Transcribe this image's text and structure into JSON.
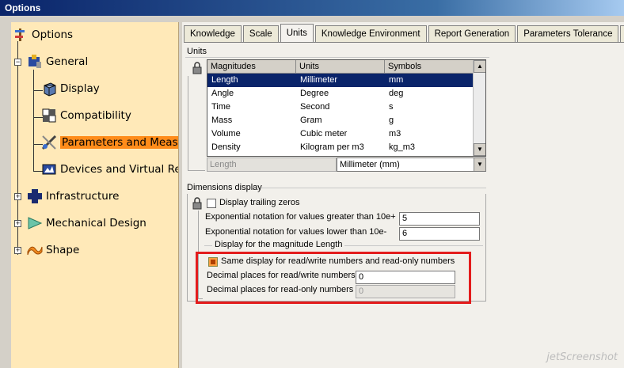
{
  "window": {
    "title": "Options"
  },
  "tree": {
    "items": [
      {
        "label": "Options",
        "icon": "options-icon"
      },
      {
        "label": "General",
        "icon": "general-icon"
      },
      {
        "label": "Display",
        "icon": "display-cube-icon"
      },
      {
        "label": "Compatibility",
        "icon": "compatibility-icon"
      },
      {
        "label": "Parameters and Measure",
        "icon": "parameters-measure-icon"
      },
      {
        "label": "Devices and Virtual Reali",
        "icon": "devices-icon"
      },
      {
        "label": "Infrastructure",
        "icon": "infrastructure-icon"
      },
      {
        "label": "Mechanical Design",
        "icon": "mechanical-design-icon"
      },
      {
        "label": "Shape",
        "icon": "shape-icon"
      }
    ]
  },
  "tabs": [
    {
      "label": "Knowledge"
    },
    {
      "label": "Scale"
    },
    {
      "label": "Units"
    },
    {
      "label": "Knowledge Environment"
    },
    {
      "label": "Report Generation"
    },
    {
      "label": "Parameters Tolerance"
    },
    {
      "label": "M"
    }
  ],
  "units_group": {
    "title": "Units",
    "headers": [
      "Magnitudes",
      "Units",
      "Symbols"
    ],
    "rows": [
      {
        "magnitude": "Length",
        "unit": "Millimeter",
        "symbol": "mm"
      },
      {
        "magnitude": "Angle",
        "unit": "Degree",
        "symbol": "deg"
      },
      {
        "magnitude": "Time",
        "unit": "Second",
        "symbol": "s"
      },
      {
        "magnitude": "Mass",
        "unit": "Gram",
        "symbol": "g"
      },
      {
        "magnitude": "Volume",
        "unit": "Cubic meter",
        "symbol": "m3"
      },
      {
        "magnitude": "Density",
        "unit": "Kilogram per m3",
        "symbol": "kg_m3"
      }
    ],
    "selected_magnitude": "Length",
    "selected_unit": "Millimeter (mm)"
  },
  "dimensions_group": {
    "title": "Dimensions display",
    "trailing_zeros_label": "Display trailing zeros",
    "exp_greater_label": "Exponential notation for values greater than 10e+",
    "exp_greater_value": "5",
    "exp_lower_label": "Exponential notation for values lower than 10e-",
    "exp_lower_value": "6",
    "magnitude_subgroup_title": "Display for the magnitude Length",
    "same_display_label": "Same display for read/write numbers and read-only numbers",
    "decimal_rw_label": "Decimal places for read/write numbers",
    "decimal_rw_value": "0",
    "decimal_ro_label": "Decimal places for read-only numbers",
    "decimal_ro_value": "0"
  },
  "watermark": "jetScreenshot",
  "colors": {
    "tree_bg": "#ffe9b8",
    "selection": "#ff8c1a",
    "highlight_box": "#e31c1c",
    "title_bar": "#0a246a"
  }
}
